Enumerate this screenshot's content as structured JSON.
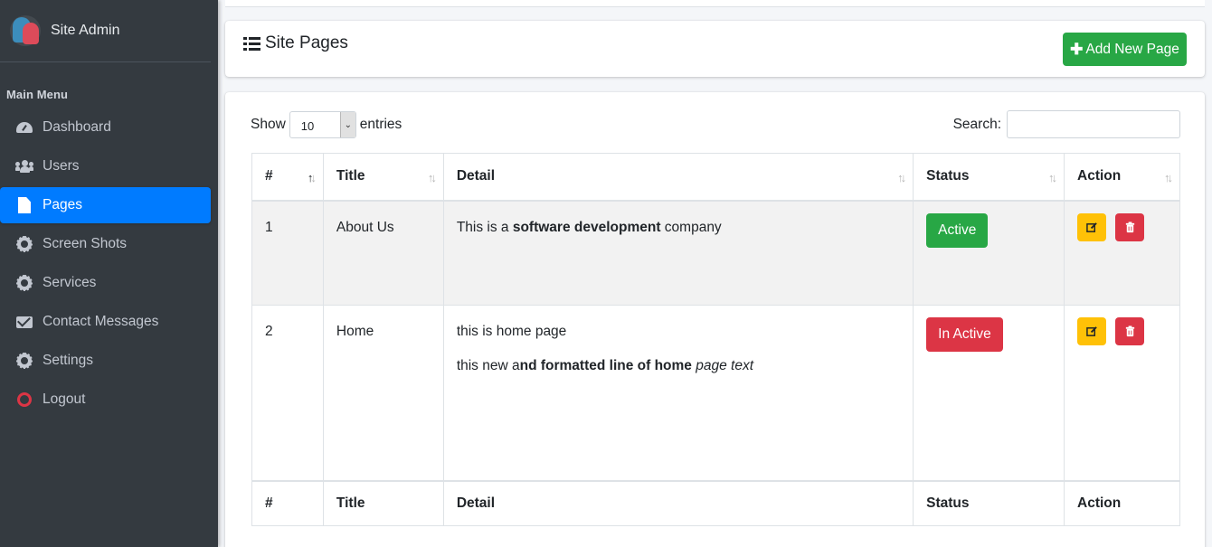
{
  "sidebar": {
    "brand": "Site Admin",
    "menu_header": "Main Menu",
    "items": [
      {
        "label": "Dashboard",
        "icon": "tachometer-icon"
      },
      {
        "label": "Users",
        "icon": "users-icon"
      },
      {
        "label": "Pages",
        "icon": "file-icon",
        "active": true
      },
      {
        "label": "Screen Shots",
        "icon": "gear-icon"
      },
      {
        "label": "Services",
        "icon": "gear-icon"
      },
      {
        "label": "Contact Messages",
        "icon": "envelope-icon"
      },
      {
        "label": "Settings",
        "icon": "gear-icon"
      },
      {
        "label": "Logout",
        "icon": "power-circle-icon"
      }
    ]
  },
  "header": {
    "title": "Site Pages",
    "add_button": "Add New Page",
    "add_plus": "✚"
  },
  "table_controls": {
    "show_label": "Show",
    "entries_value": "10",
    "entries_label": "entries",
    "search_label": "Search:"
  },
  "table": {
    "columns": [
      "#",
      "Title",
      "Detail",
      "Status",
      "Action"
    ],
    "rows": [
      {
        "num": "1",
        "title": "About Us",
        "detail_pre": "This is a ",
        "detail_bold": "software development",
        "detail_post": " company",
        "status": "Active"
      },
      {
        "num": "2",
        "title": "Home",
        "detail_line1": "this is home page",
        "detail_line2_pre": "this new a",
        "detail_line2_bold": "nd formatted line of home",
        "detail_line2_italic": " page text",
        "status": "In Active"
      }
    ]
  },
  "colors": {
    "sidebar_bg": "#343a40",
    "accent": "#007bff",
    "success": "#28a745",
    "danger": "#dc3545",
    "warning": "#ffc107"
  }
}
